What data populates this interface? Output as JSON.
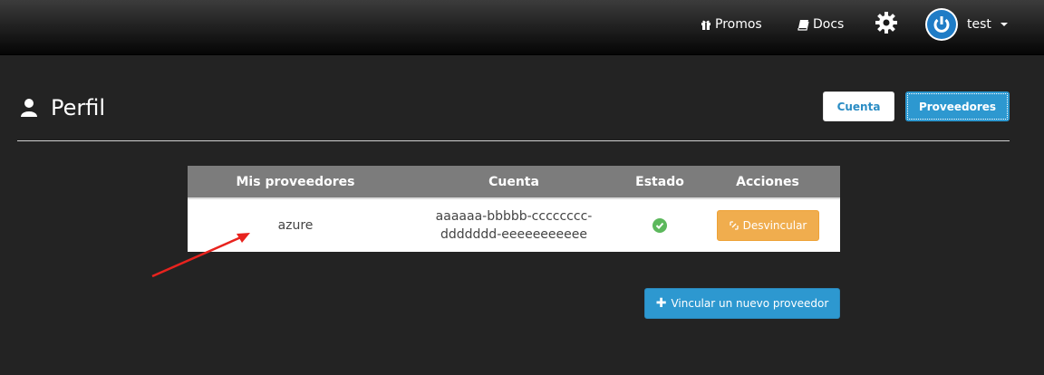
{
  "navbar": {
    "promos_label": "Promos",
    "docs_label": "Docs",
    "user_label": "test",
    "icons": {
      "promos": "gift-icon",
      "docs": "book-icon",
      "settings": "gear-icon",
      "avatar": "power-icon",
      "caret": "caret-down-icon"
    }
  },
  "page": {
    "title": "Perfil",
    "title_icon": "user-icon",
    "tabs": {
      "cuenta_label": "Cuenta",
      "proveedores_label": "Proveedores"
    }
  },
  "providers_table": {
    "headers": [
      "Mis proveedores",
      "Cuenta",
      "Estado",
      "Acciones"
    ],
    "rows": [
      {
        "provider": "azure",
        "account_line1": "aaaaaa-bbbbb-cccccccc-",
        "account_line2": "ddddddd-eeeeeeeeeee",
        "status_icon": "check-circle-icon",
        "action_label": "Desvincular",
        "action_icon": "unlink-icon"
      }
    ]
  },
  "link_new_button": {
    "label": "Vincular un nuevo proveedor",
    "icon": "plus-icon"
  },
  "colors": {
    "background": "#232323",
    "primary": "#2d98d0",
    "warning": "#f0ad4e",
    "success": "#5cb85c",
    "annotation_arrow": "#e8231e"
  }
}
